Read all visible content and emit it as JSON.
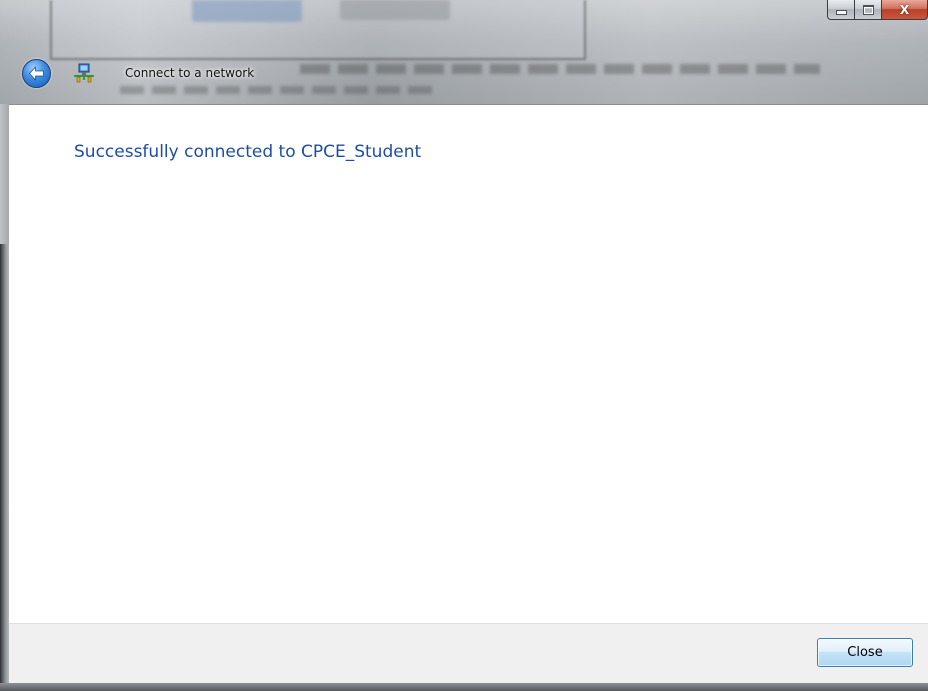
{
  "window": {
    "title": "Connect to a network",
    "caption_buttons": {
      "minimize_icon": "minimize-icon",
      "maximize_icon": "maximize-icon",
      "close_icon": "close-icon",
      "close_glyph": "X"
    }
  },
  "nav": {
    "back_icon": "back-arrow-icon",
    "app_icon": "network-connection-icon"
  },
  "content": {
    "main_instruction": "Successfully connected to CPCE_Student"
  },
  "footer": {
    "close_label": "Close"
  },
  "colors": {
    "instruction_text": "#1c4ea8",
    "close_caption": "#c9573d",
    "button_border": "#3c7fb1"
  }
}
